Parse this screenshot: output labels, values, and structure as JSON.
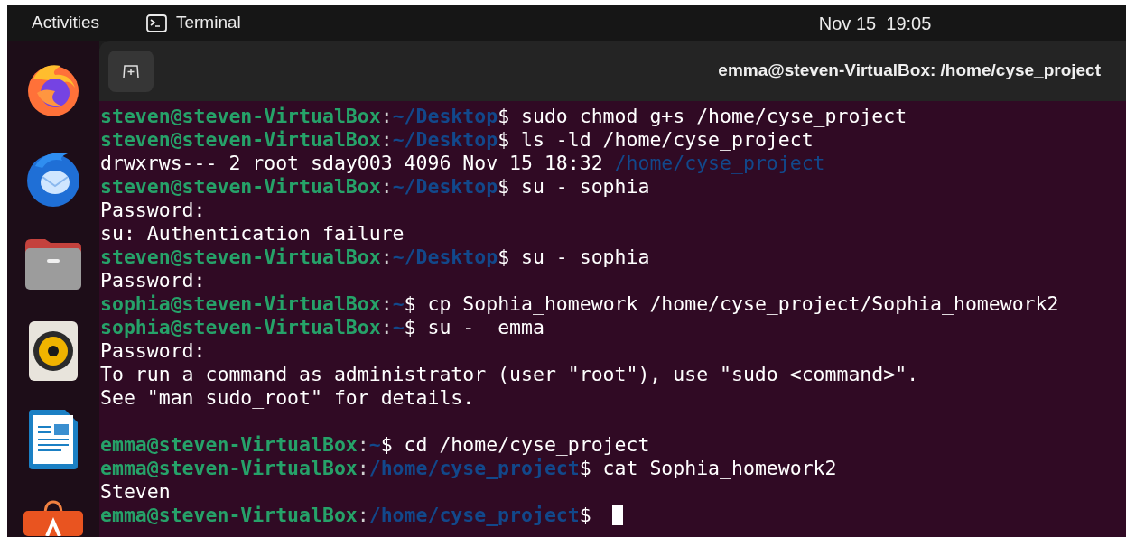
{
  "top_bar": {
    "activities": "Activities",
    "app_name": "Terminal",
    "clock": "Nov 15  19:05"
  },
  "dock": {
    "apps": [
      {
        "kind": "browser"
      },
      {
        "kind": "mail"
      },
      {
        "kind": "files"
      },
      {
        "kind": "music"
      },
      {
        "kind": "writer"
      },
      {
        "kind": "store"
      }
    ]
  },
  "window": {
    "title": "emma@steven-VirtualBox: /home/cyse_project"
  },
  "terminal": {
    "lines": [
      {
        "kind": "prompt",
        "user_host": "steven@steven-VirtualBox",
        "separator": ":",
        "path": "~/Desktop",
        "command": "$ sudo chmod g+s /home/cyse_project"
      },
      {
        "kind": "prompt",
        "user_host": "steven@steven-VirtualBox",
        "separator": ":",
        "path": "~/Desktop",
        "command": "$ ls -ld /home/cyse_project"
      },
      {
        "kind": "listing",
        "text": "drwxrws--- 2 root sday003 4096 Nov 15 18:32 ",
        "path": "/home/cyse_project"
      },
      {
        "kind": "prompt",
        "user_host": "steven@steven-VirtualBox",
        "separator": ":",
        "path": "~/Desktop",
        "command": "$ su - sophia"
      },
      {
        "kind": "output",
        "text": "Password:"
      },
      {
        "kind": "output",
        "text": "su: Authentication failure"
      },
      {
        "kind": "prompt",
        "user_host": "steven@steven-VirtualBox",
        "separator": ":",
        "path": "~/Desktop",
        "command": "$ su - sophia"
      },
      {
        "kind": "output",
        "text": "Password:"
      },
      {
        "kind": "prompt",
        "user_host": "sophia@steven-VirtualBox",
        "separator": ":",
        "path": "~",
        "command": "$ cp Sophia_homework /home/cyse_project/Sophia_homework2"
      },
      {
        "kind": "prompt",
        "user_host": "sophia@steven-VirtualBox",
        "separator": ":",
        "path": "~",
        "command": "$ su -  emma"
      },
      {
        "kind": "output",
        "text": "Password:"
      },
      {
        "kind": "output",
        "text": "To run a command as administrator (user \"root\"), use \"sudo <command>\"."
      },
      {
        "kind": "output",
        "text": "See \"man sudo_root\" for details."
      },
      {
        "kind": "blank"
      },
      {
        "kind": "prompt",
        "user_host": "emma@steven-VirtualBox",
        "separator": ":",
        "path": "~",
        "command": "$ cd /home/cyse_project"
      },
      {
        "kind": "prompt",
        "user_host": "emma@steven-VirtualBox",
        "separator": ":",
        "path": "/home/cyse_project",
        "command": "$ cat Sophia_homework2"
      },
      {
        "kind": "output",
        "text": "Steven"
      },
      {
        "kind": "prompt",
        "user_host": "emma@steven-VirtualBox",
        "separator": ":",
        "path": "/home/cyse_project",
        "command": "$",
        "cursor": true
      }
    ]
  }
}
